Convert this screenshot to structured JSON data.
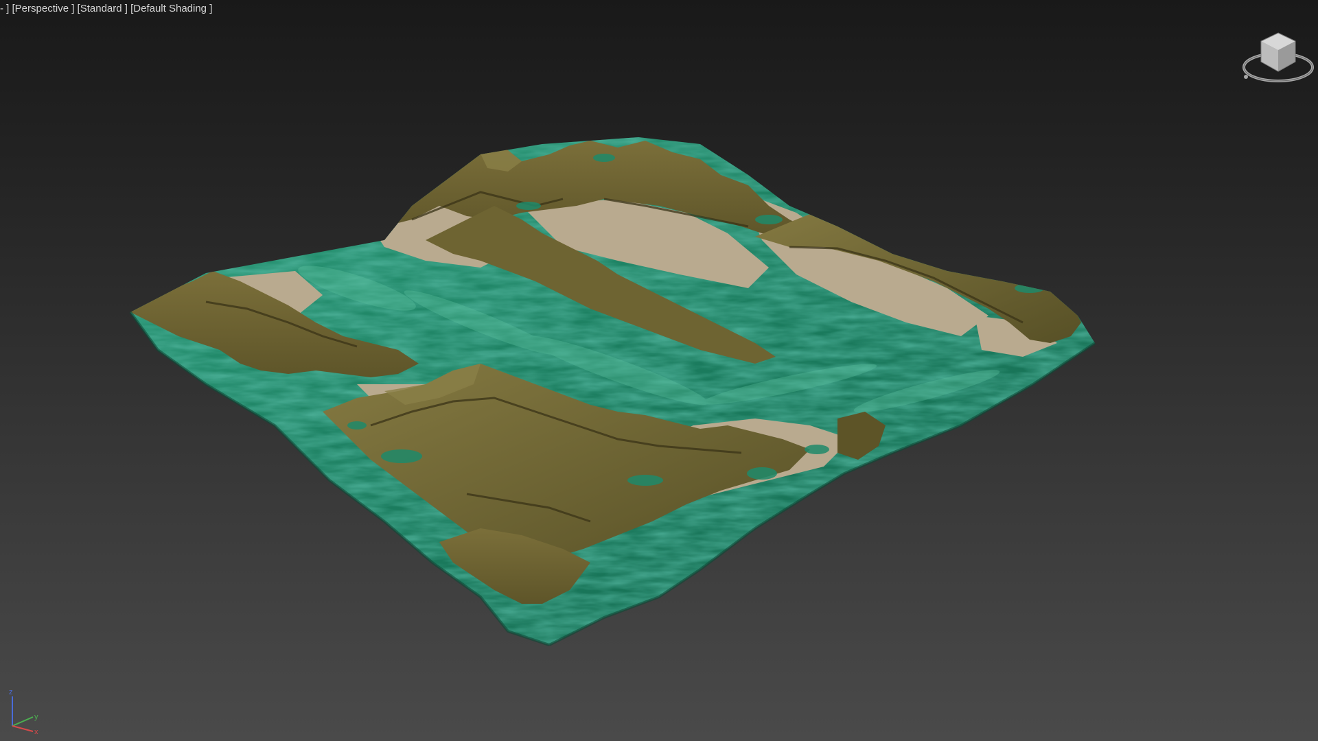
{
  "viewport": {
    "label_menu": "-",
    "label_view": "Perspective",
    "label_visual_style": "Standard",
    "label_shading": "Default Shading"
  },
  "viewcube": {
    "icon": "viewcube-navigation-icon"
  },
  "axis_tripod": {
    "z_label": "z",
    "y_label": "y",
    "x_label": "x",
    "colors": {
      "z": "#4a6bd8",
      "y": "#4caf50",
      "x": "#d84a4a"
    }
  },
  "scene": {
    "object": "terrain-mesh",
    "colors": {
      "rock_olive": "#6e6432",
      "rock_shadow": "#4d4521",
      "rock_light": "#857a42",
      "sand_tan": "#b7a88d",
      "grass_teal": "#1f8a6a",
      "grass_dark": "#14624a",
      "grass_light": "#3fae8c"
    }
  }
}
